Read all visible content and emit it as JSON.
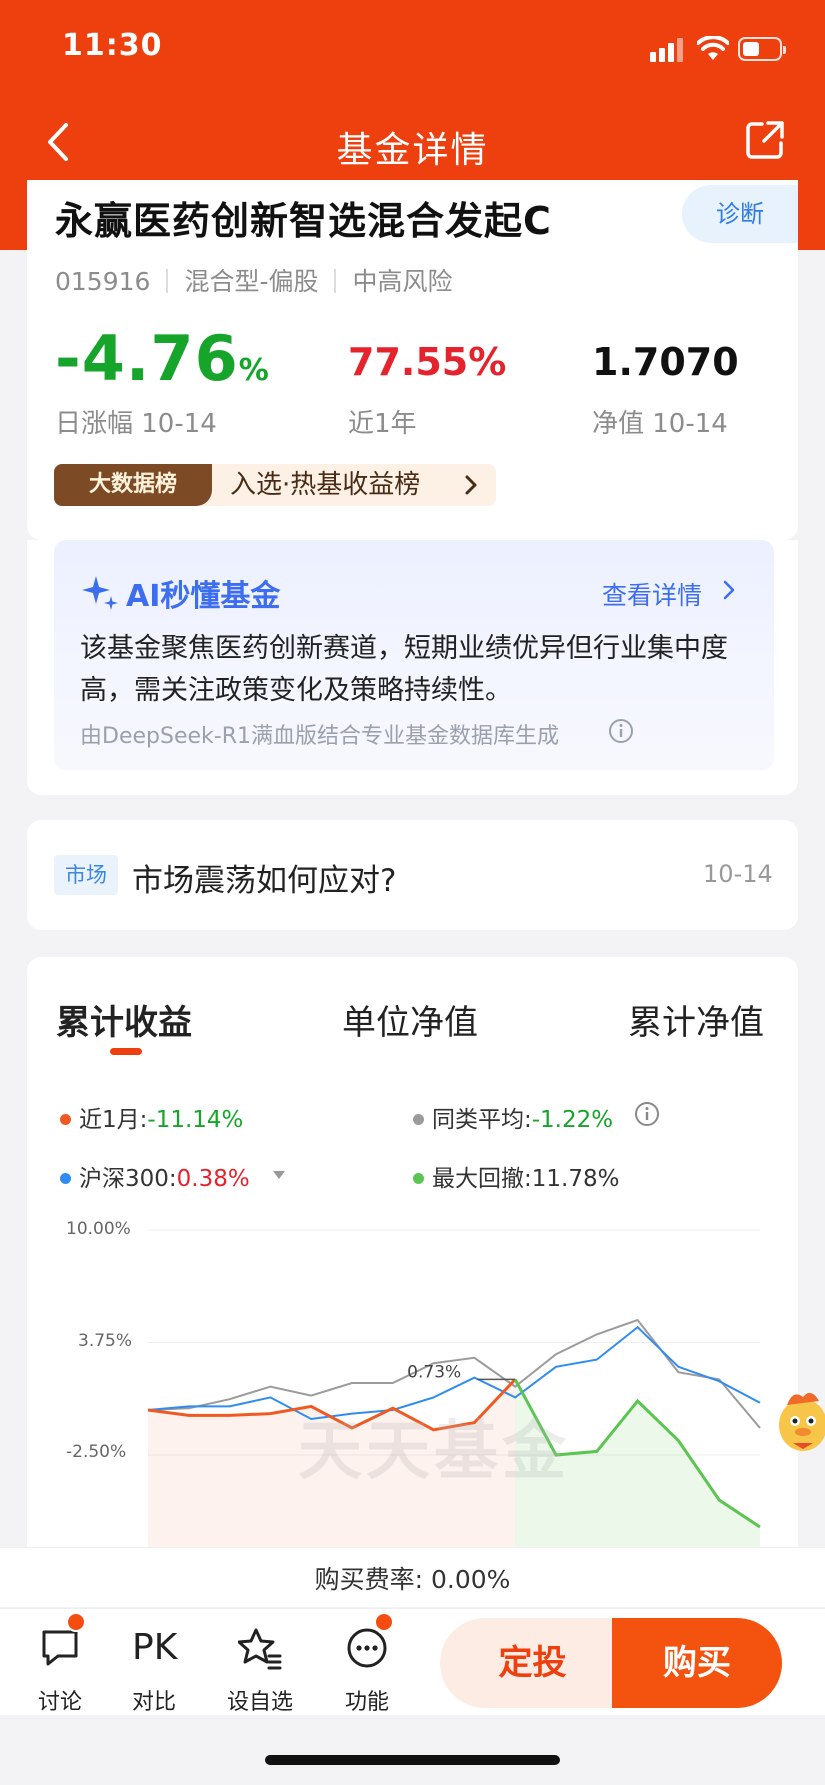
{
  "status": {
    "time": "11:30"
  },
  "nav": {
    "title": "基金详情"
  },
  "fund": {
    "name": "永赢医药创新智选混合发起C",
    "code": "015916",
    "type": "混合型-偏股",
    "risk": "中高风险",
    "diagnose_label": "诊断",
    "daily_change_value": "-4.76",
    "daily_change_unit": "%",
    "daily_change_label": "日涨幅 10-14",
    "year_return": "77.55%",
    "year_label": "近1年",
    "nav_value": "1.7070",
    "nav_label": "净值 10-14",
    "rank_badge": "大数据榜",
    "rank_text": "入选·热基收益榜"
  },
  "ai": {
    "title": "AI秒懂基金",
    "more": "查看详情",
    "body": "该基金聚焦医药创新赛道，短期业绩优异但行业集中度高，需关注政策变化及策略持续性。",
    "source": "由DeepSeek-R1满血版结合专业基金数据库生成"
  },
  "market": {
    "tag": "市场",
    "title": "市场震荡如何应对?",
    "date": "10-14"
  },
  "tabs": [
    "累计收益",
    "单位净值",
    "累计净值"
  ],
  "legend": {
    "fund_label": "近1月:",
    "fund_value": "-11.14%",
    "fund_color": "#f05a22",
    "peer_label": "同类平均:",
    "peer_value": "-1.22%",
    "peer_color": "#9b9b9b",
    "index_label": "沪深300:",
    "index_value": "0.38%",
    "index_color": "#2f8cf0",
    "dd_label": "最大回撤:",
    "dd_value": "11.78%",
    "dd_color": "#5cc552"
  },
  "chart_data": {
    "type": "line",
    "y_ticks": [
      "10.00%",
      "3.75%",
      "-2.50%"
    ],
    "ylim": [
      -6.5,
      10
    ],
    "point_label": "0.73%",
    "series": [
      {
        "name": "近1月",
        "values": [
          0,
          -0.3,
          -0.3,
          -0.2,
          0.2,
          -1.0,
          0.1,
          -1.1,
          -0.7,
          1.7,
          -2.5,
          -2.3,
          0.5,
          -1.7,
          -5.0,
          -6.5
        ]
      },
      {
        "name": "同类平均",
        "values": [
          0,
          0.1,
          0.6,
          1.3,
          0.8,
          1.5,
          1.5,
          2.6,
          2.9,
          1.3,
          3.1,
          4.2,
          5.0,
          2.1,
          1.7,
          -1.0
        ]
      },
      {
        "name": "沪深300",
        "values": [
          0,
          0.2,
          0.2,
          0.7,
          -0.5,
          -0.2,
          0.0,
          0.7,
          1.8,
          0.7,
          2.4,
          2.8,
          4.6,
          2.4,
          1.6,
          0.4
        ]
      }
    ]
  },
  "watermark": "天天基金",
  "fee_text": "购买费率: 0.00%",
  "bottom": {
    "discuss": "讨论",
    "pk_icon": "PK",
    "compare": "对比",
    "watch": "设自选",
    "func": "功能",
    "aip": "定投",
    "buy": "购买"
  }
}
